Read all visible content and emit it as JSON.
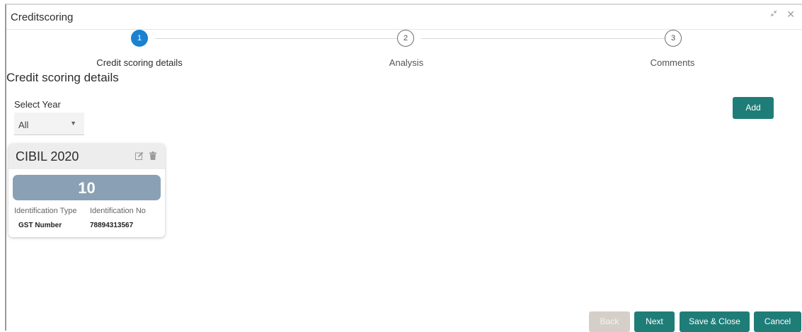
{
  "window": {
    "title": "Creditscoring"
  },
  "stepper": {
    "steps": [
      {
        "number": "1",
        "label": "Credit scoring details",
        "state": "active"
      },
      {
        "number": "2",
        "label": "Analysis",
        "state": "inactive"
      },
      {
        "number": "3",
        "label": "Comments",
        "state": "inactive"
      }
    ]
  },
  "section": {
    "title": "Credit scoring details"
  },
  "filter": {
    "label": "Select Year",
    "selected": "All"
  },
  "actions": {
    "add_label": "Add"
  },
  "card": {
    "title": "CIBIL 2020",
    "score": "10",
    "id_type_label": "Identification Type",
    "id_no_label": "Identification No",
    "id_type_value": "GST Number",
    "id_no_value": "78894313567"
  },
  "footer": {
    "back_label": "Back",
    "next_label": "Next",
    "save_close_label": "Save & Close",
    "cancel_label": "Cancel"
  },
  "colors": {
    "accent": "#1f7d78",
    "step_active": "#1b82d1",
    "score_bar": "#8aa0b4",
    "disabled_button": "#d6cfc8"
  }
}
